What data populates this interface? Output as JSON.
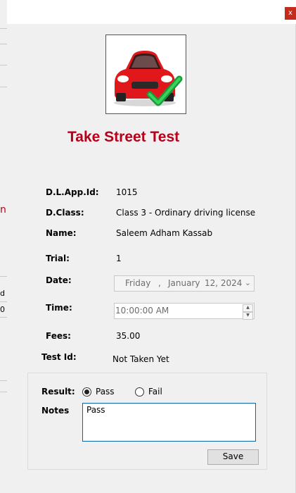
{
  "window": {
    "close_label": "x"
  },
  "background_app": {
    "glimpse_chars": [
      "n",
      "d",
      "0"
    ]
  },
  "header": {
    "title": "Take Street Test",
    "image_icon": "car-check-icon"
  },
  "fields": {
    "app_id_label": "D.L.App.Id:",
    "app_id_value": "1015",
    "class_label": "D.Class:",
    "class_value": "Class 3 - Ordinary driving license",
    "name_label": "Name:",
    "name_value": "Saleem Adham Kassab",
    "trial_label": "Trial:",
    "trial_value": "1",
    "date_label": "Date:",
    "date_day": "Friday",
    "date_sep": ",",
    "date_month": "January",
    "date_daynum_year": "12, 2024",
    "time_label": "Time:",
    "time_value": "10:00:00 AM",
    "fees_label": "Fees:",
    "fees_value": "35.00",
    "test_id_label": "Test Id:",
    "test_id_value": "Not Taken Yet"
  },
  "result": {
    "label": "Result:",
    "pass_label": "Pass",
    "fail_label": "Fail",
    "selected": "Pass",
    "notes_label": "Notes",
    "notes_value": "Pass",
    "save_label": "Save"
  },
  "colors": {
    "title": "#b5001a",
    "close_button": "#c42b1c",
    "notes_border": "#0a64ad"
  }
}
